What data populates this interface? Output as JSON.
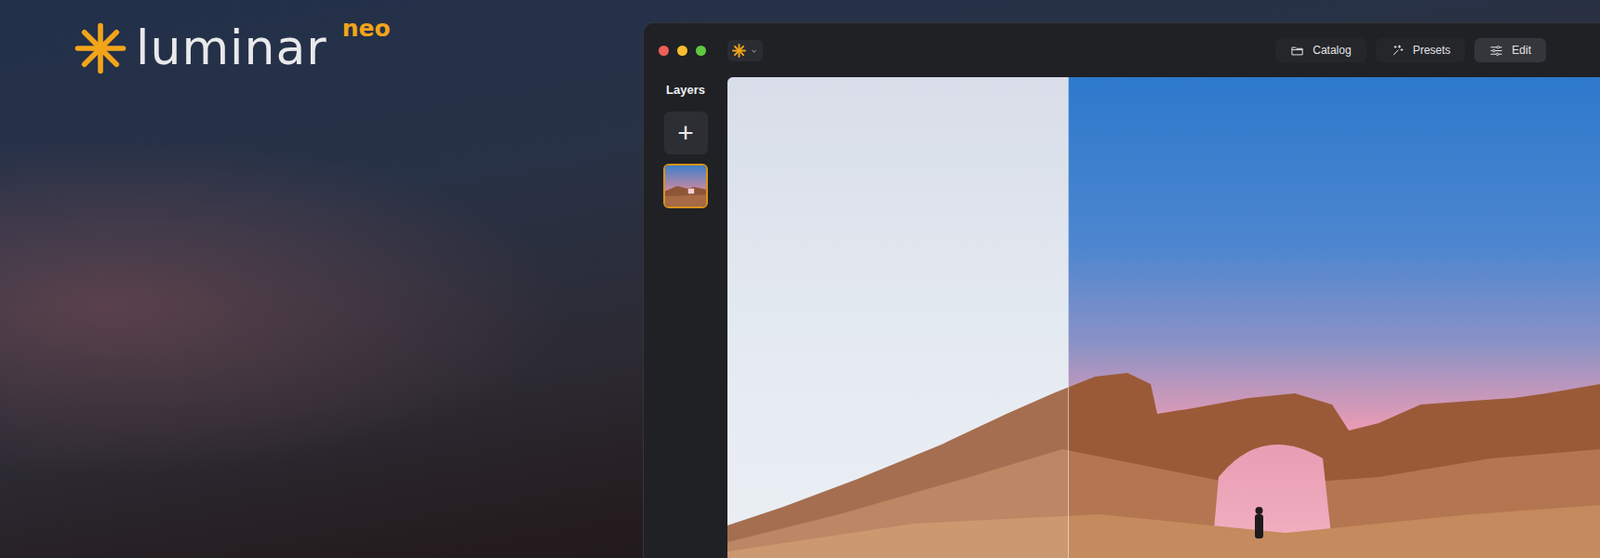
{
  "logo": {
    "word": "luminar",
    "badge": "neo"
  },
  "tabs": [
    {
      "label": "Catalog",
      "selected": false
    },
    {
      "label": "Presets",
      "selected": false
    },
    {
      "label": "Edit",
      "selected": true
    }
  ],
  "layers": {
    "title": "Layers",
    "add": "+",
    "items": [
      {
        "selected": true
      }
    ]
  },
  "compare": {
    "level": 0.39
  }
}
